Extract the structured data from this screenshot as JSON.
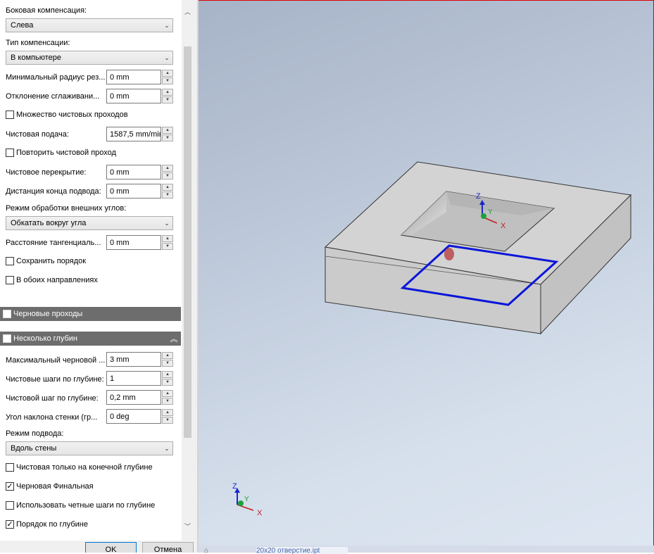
{
  "panel": {
    "lateral_label": "Боковая компенсация:",
    "lateral_value": "Слева",
    "comp_type_label": "Тип компенсации:",
    "comp_type_value": "В компьютере",
    "min_radius_label": "Минимальный радиус рез...",
    "min_radius_value": "0 mm",
    "smooth_dev_label": "Отклонение сглаживани...",
    "smooth_dev_value": "0 mm",
    "multi_finish_label": "Множество чистовых проходов",
    "multi_finish_checked": false,
    "finish_feed_label": "Чистовая подача:",
    "finish_feed_value": "1587,5 mm/min",
    "repeat_finish_label": "Повторить чистовой проход",
    "repeat_finish_checked": false,
    "finish_overlap_label": "Чистовое перекрытие:",
    "finish_overlap_value": "0 mm",
    "lead_end_label": "Дистанция конца подвода:",
    "lead_end_value": "0 mm",
    "outer_corner_label": "Режим обработки внешних углов:",
    "outer_corner_value": "Обкатать вокруг угла",
    "tangential_label": "Расстояние тангенциаль...",
    "tangential_value": "0 mm",
    "keep_order_label": "Сохранить порядок",
    "keep_order_checked": false,
    "both_dir_label": "В обоих направлениях",
    "both_dir_checked": false,
    "roughing_section": "Черновые проходы",
    "roughing_checked": false,
    "multi_depth_section": "Несколько глубин",
    "multi_depth_checked": true,
    "max_rough_label": "Максимальный черновой ...",
    "max_rough_value": "3 mm",
    "finish_steps_label": "Чистовые шаги по глубине:",
    "finish_steps_value": "1",
    "finish_step_label": "Чистовой шаг по глубине:",
    "finish_step_value": "0,2 mm",
    "wall_angle_label": "Угол наклона стенки (гр...",
    "wall_angle_value": "0 deg",
    "approach_label": "Режим подвода:",
    "approach_value": "Вдоль стены",
    "finish_final_label": "Чистовая только на конечной глубине",
    "finish_final_checked": false,
    "rough_final_label": "Черновая Финальная",
    "rough_final_checked": true,
    "even_steps_label": "Использовать четные шаги по глубине",
    "even_steps_checked": false,
    "order_depth_label": "Порядок по глубине",
    "order_depth_checked": true,
    "ok_label": "OK",
    "cancel_label": "Отмена"
  },
  "viewport": {
    "axis_x": "X",
    "axis_y": "Y",
    "axis_z": "Z",
    "tab_label": "20x20 отверстие.ipt"
  }
}
